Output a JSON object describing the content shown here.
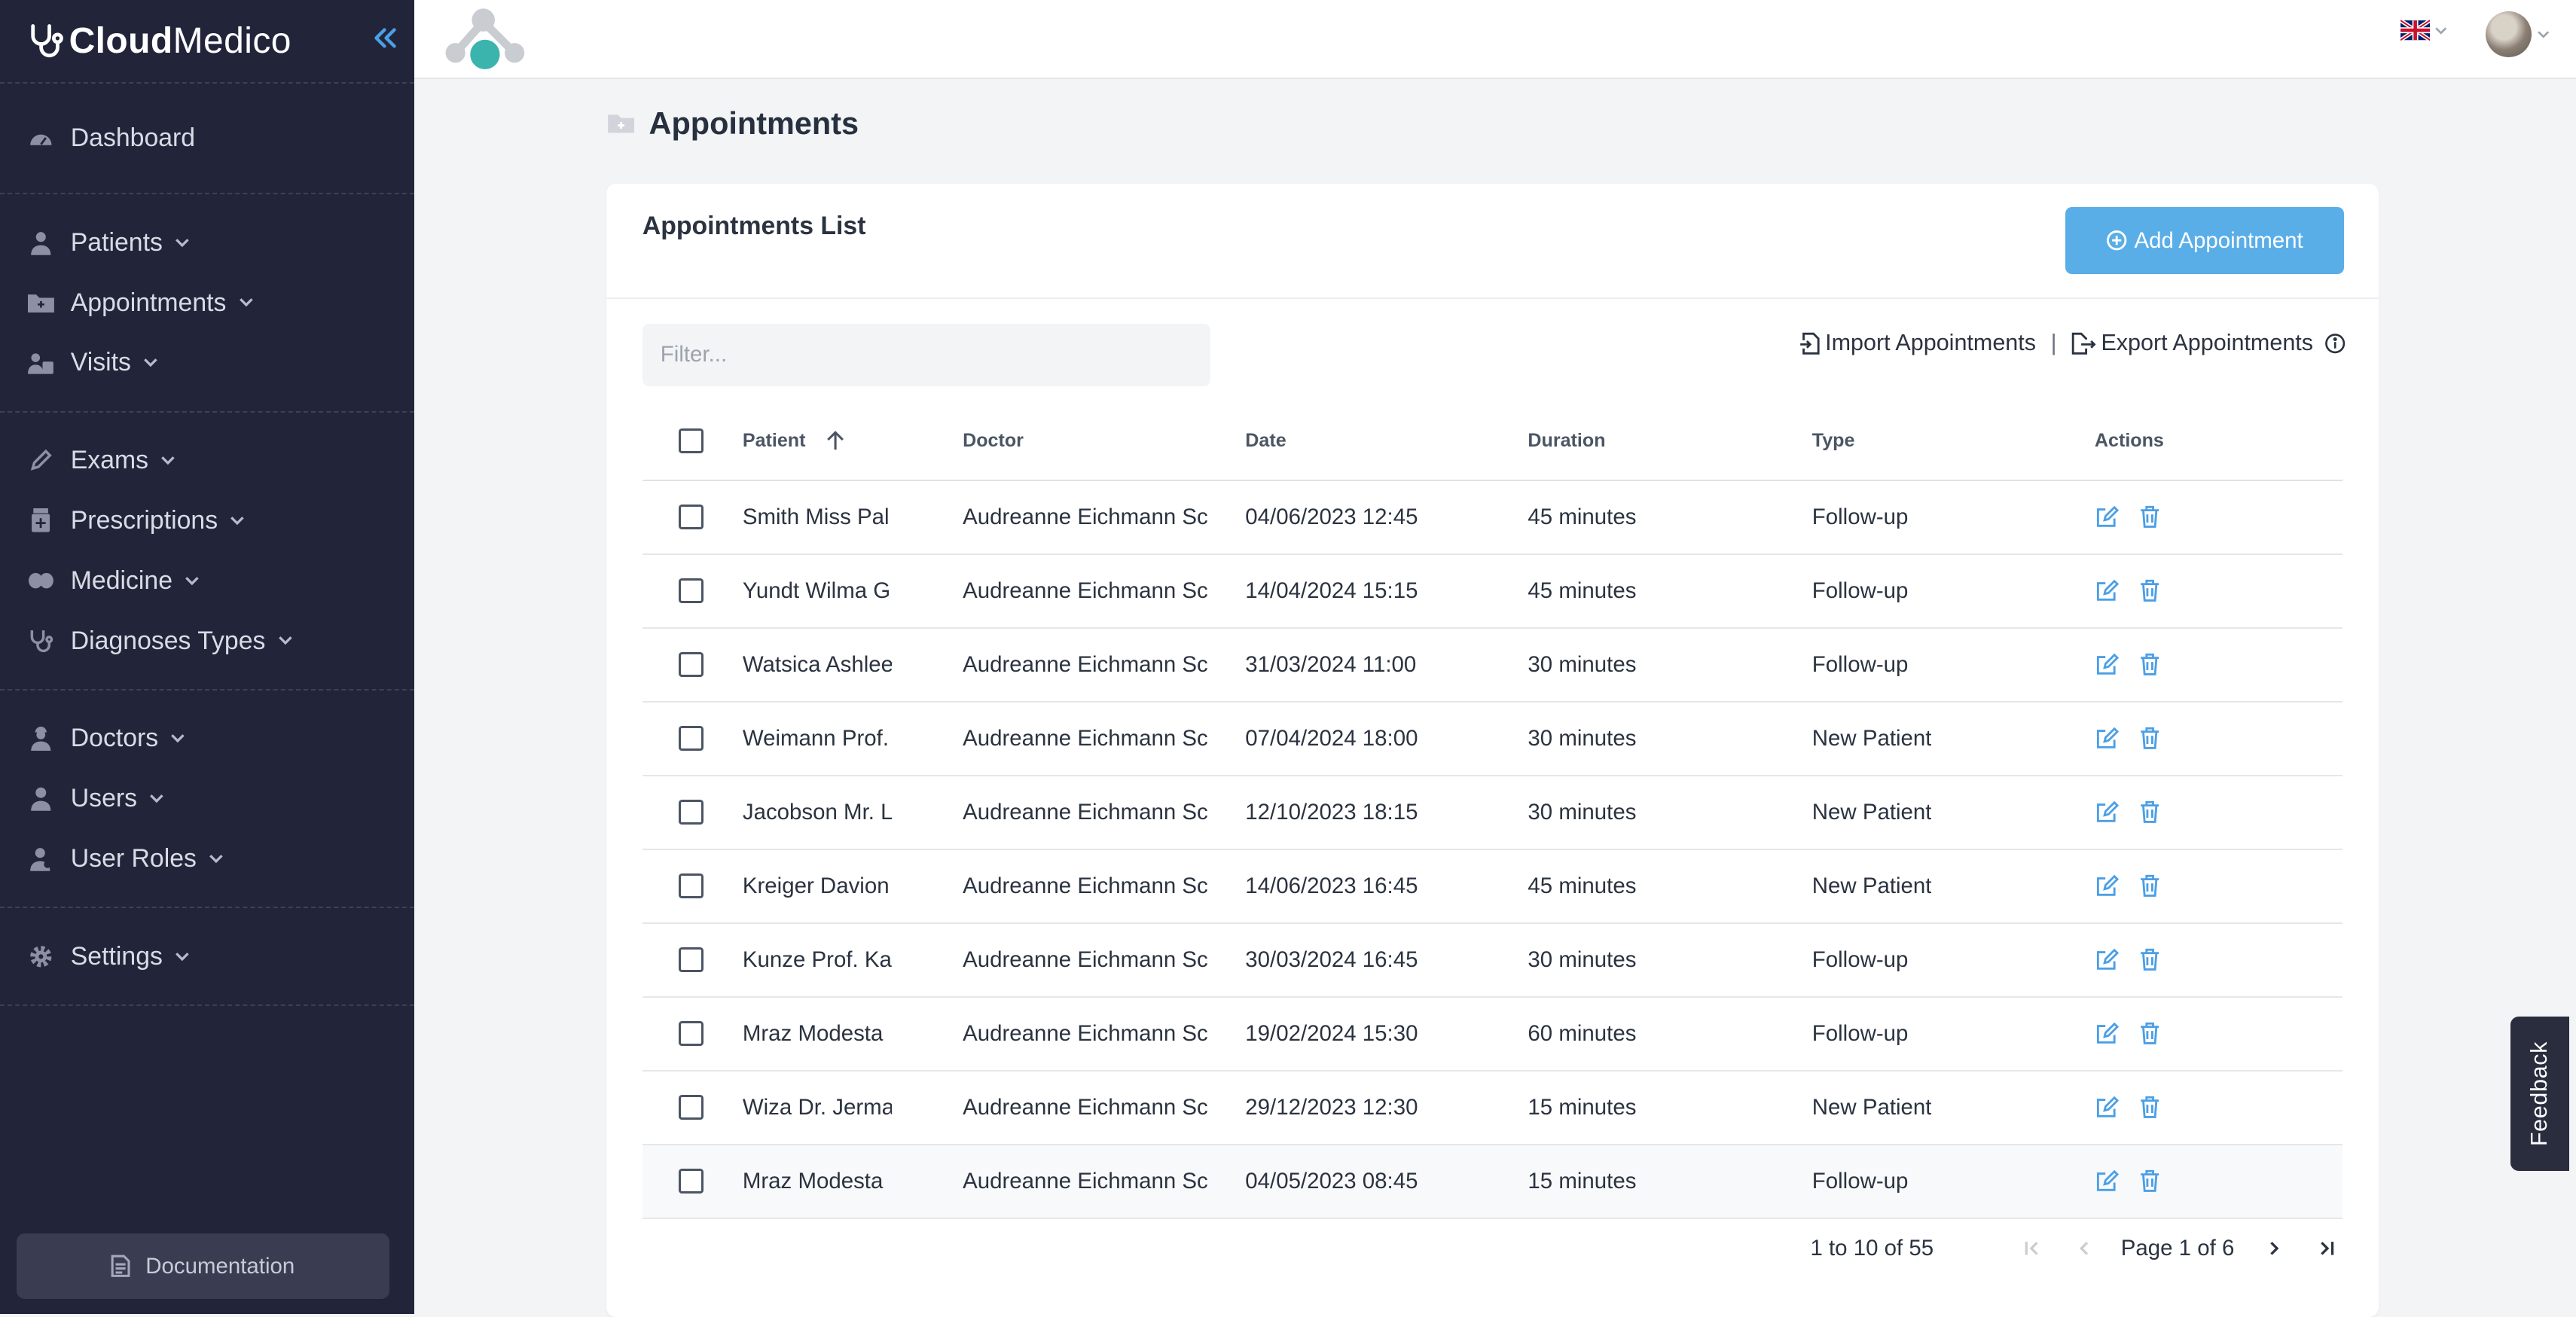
{
  "brand": {
    "name_bold": "Cloud",
    "name_regular": "Medico"
  },
  "sidebar": {
    "groups": [
      [
        {
          "label": "Dashboard",
          "icon": "dashboard-icon",
          "has_children": false
        }
      ],
      [
        {
          "label": "Patients",
          "icon": "patient-icon",
          "has_children": true
        },
        {
          "label": "Appointments",
          "icon": "appointment-icon",
          "has_children": true
        },
        {
          "label": "Visits",
          "icon": "visits-icon",
          "has_children": true
        }
      ],
      [
        {
          "label": "Exams",
          "icon": "pencil-icon",
          "has_children": true
        },
        {
          "label": "Prescriptions",
          "icon": "prescription-icon",
          "has_children": true
        },
        {
          "label": "Medicine",
          "icon": "pills-icon",
          "has_children": true
        },
        {
          "label": "Diagnoses Types",
          "icon": "stethoscope-icon",
          "has_children": true
        }
      ],
      [
        {
          "label": "Doctors",
          "icon": "doctor-icon",
          "has_children": true
        },
        {
          "label": "Users",
          "icon": "user-icon",
          "has_children": true
        },
        {
          "label": "User Roles",
          "icon": "user-roles-icon",
          "has_children": true
        }
      ],
      [
        {
          "label": "Settings",
          "icon": "gear-icon",
          "has_children": true
        }
      ]
    ],
    "documentation_label": "Documentation"
  },
  "page": {
    "title": "Appointments"
  },
  "card": {
    "title": "Appointments List",
    "add_button_label": "Add Appointment",
    "filter_placeholder": "Filter...",
    "import_label": "Import Appointments",
    "separator": "|",
    "export_label": "Export Appointments"
  },
  "table": {
    "columns": [
      "Patient",
      "Doctor",
      "Date",
      "Duration",
      "Type",
      "Actions"
    ],
    "sorted_column": "Patient",
    "sort_direction": "ascending",
    "rows": [
      {
        "patient": "Smith Miss Pal",
        "doctor": "Audreanne Eichmann Sc",
        "date": "04/06/2023 12:45",
        "duration": "45 minutes",
        "type": "Follow-up"
      },
      {
        "patient": "Yundt Wilma G",
        "doctor": "Audreanne Eichmann Sc",
        "date": "14/04/2024 15:15",
        "duration": "45 minutes",
        "type": "Follow-up"
      },
      {
        "patient": "Watsica Ashlee",
        "doctor": "Audreanne Eichmann Sc",
        "date": "31/03/2024 11:00",
        "duration": "30 minutes",
        "type": "Follow-up"
      },
      {
        "patient": "Weimann Prof.",
        "doctor": "Audreanne Eichmann Sc",
        "date": "07/04/2024 18:00",
        "duration": "30 minutes",
        "type": "New Patient"
      },
      {
        "patient": "Jacobson Mr. L",
        "doctor": "Audreanne Eichmann Sc",
        "date": "12/10/2023 18:15",
        "duration": "30 minutes",
        "type": "New Patient"
      },
      {
        "patient": "Kreiger Davion",
        "doctor": "Audreanne Eichmann Sc",
        "date": "14/06/2023 16:45",
        "duration": "45 minutes",
        "type": "New Patient"
      },
      {
        "patient": "Kunze Prof. Ka",
        "doctor": "Audreanne Eichmann Sc",
        "date": "30/03/2024 16:45",
        "duration": "30 minutes",
        "type": "Follow-up"
      },
      {
        "patient": "Mraz Modesta",
        "doctor": "Audreanne Eichmann Sc",
        "date": "19/02/2024 15:30",
        "duration": "60 minutes",
        "type": "Follow-up"
      },
      {
        "patient": "Wiza Dr. Jerma",
        "doctor": "Audreanne Eichmann Sc",
        "date": "29/12/2023 12:30",
        "duration": "15 minutes",
        "type": "New Patient"
      },
      {
        "patient": "Mraz Modesta",
        "doctor": "Audreanne Eichmann Sc",
        "date": "04/05/2023 08:45",
        "duration": "15 minutes",
        "type": "Follow-up"
      }
    ]
  },
  "pagination": {
    "range_text": "1 to 10 of 55",
    "page_text": "Page 1 of 6"
  },
  "feedback_label": "Feedback",
  "colors": {
    "sidebar_bg": "#22253a",
    "accent": "#5aaee8",
    "action_icon": "#4b9fe6",
    "feedback_bg": "#2a2d3e"
  }
}
